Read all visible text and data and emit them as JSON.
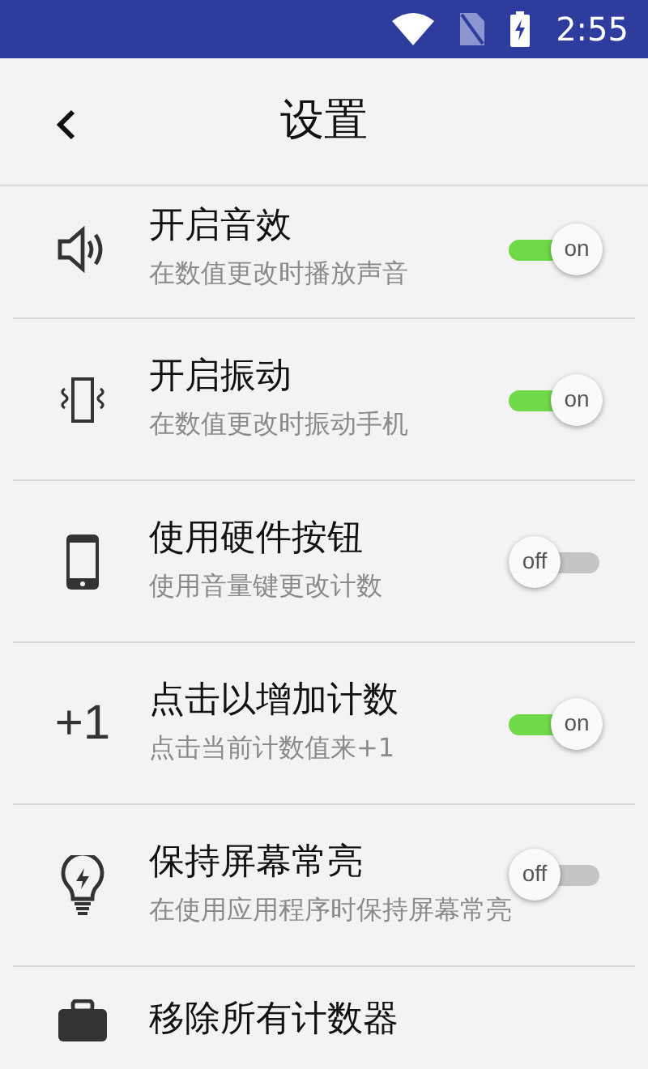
{
  "status_bar": {
    "time": "2:55"
  },
  "header": {
    "title": "设置"
  },
  "settings": [
    {
      "title": "开启音效",
      "subtitle": "在数值更改时播放声音",
      "on": true,
      "toggle_label": "on"
    },
    {
      "title": "开启振动",
      "subtitle": "在数值更改时振动手机",
      "on": true,
      "toggle_label": "on"
    },
    {
      "title": "使用硬件按钮",
      "subtitle": "使用音量键更改计数",
      "on": false,
      "toggle_label": "off"
    },
    {
      "title": "点击以增加计数",
      "subtitle": "点击当前计数值来+1",
      "on": true,
      "toggle_label": "on",
      "icon_text": "+1"
    },
    {
      "title": "保持屏幕常亮",
      "subtitle": "在使用应用程序时保持屏幕常亮",
      "on": false,
      "toggle_label": "off"
    },
    {
      "title": "移除所有计数器"
    }
  ]
}
